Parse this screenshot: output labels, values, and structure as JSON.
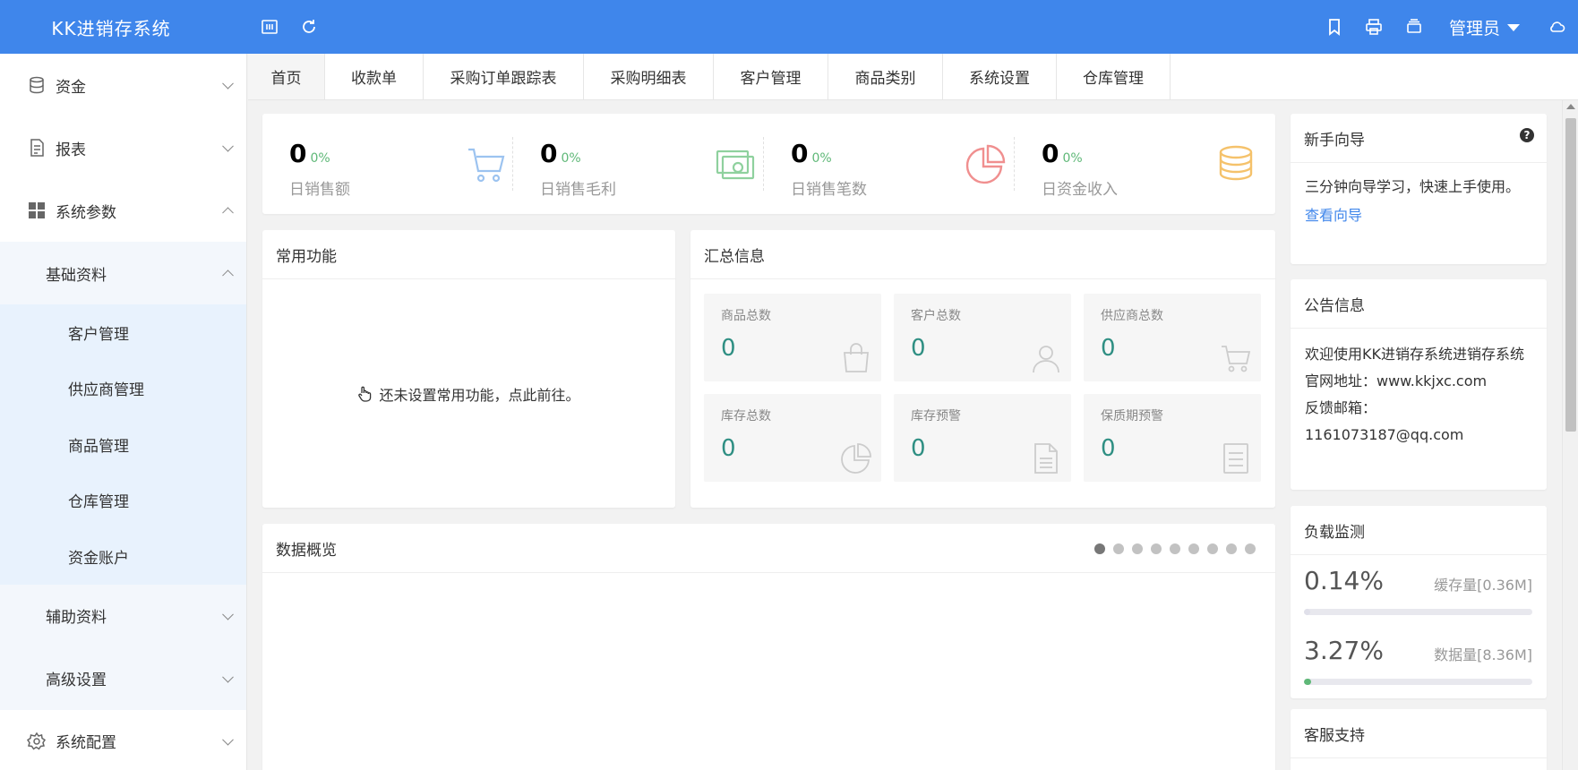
{
  "header": {
    "title": "KK进销存系统",
    "user": "管理员",
    "bg_color": "#3f86eb",
    "icons": [
      "collapse-menu-icon",
      "refresh-icon",
      "bookmark-icon",
      "print-icon",
      "layers-icon",
      "cloud-icon"
    ]
  },
  "sidebar": {
    "items": [
      {
        "label": "资金",
        "icon": "database-icon",
        "expanded": false
      },
      {
        "label": "报表",
        "icon": "report-icon",
        "expanded": false
      },
      {
        "label": "系统参数",
        "icon": "grid-icon",
        "expanded": true
      },
      {
        "label": "基础资料",
        "expanded": true
      },
      {
        "label": "客户管理"
      },
      {
        "label": "供应商管理"
      },
      {
        "label": "商品管理"
      },
      {
        "label": "仓库管理"
      },
      {
        "label": "资金账户"
      },
      {
        "label": "辅助资料",
        "expanded": false
      },
      {
        "label": "高级设置",
        "expanded": false
      },
      {
        "label": "系统配置",
        "icon": "gear-icon",
        "expanded": false
      }
    ]
  },
  "tabs": [
    "首页",
    "收款单",
    "采购订单跟踪表",
    "采购明细表",
    "客户管理",
    "商品类别",
    "系统设置",
    "仓库管理"
  ],
  "stats": [
    {
      "value": "0",
      "pct": "0%",
      "label": "日销售额",
      "icon": "cart-icon",
      "color": "#9cc3f0"
    },
    {
      "value": "0",
      "pct": "0%",
      "label": "日销售毛利",
      "icon": "money-icon",
      "color": "#8fd19e"
    },
    {
      "value": "0",
      "pct": "0%",
      "label": "日销售笔数",
      "icon": "pie-icon",
      "color": "#f08f8f"
    },
    {
      "value": "0",
      "pct": "0%",
      "label": "日资金收入",
      "icon": "coins-icon",
      "color": "#f5c26b"
    }
  ],
  "common": {
    "title": "常用功能",
    "empty_text": "还未设置常用功能，点此前往。"
  },
  "summary": {
    "title": "汇总信息",
    "cards": [
      {
        "label": "商品总数",
        "value": "0",
        "icon": "bag-icon"
      },
      {
        "label": "客户总数",
        "value": "0",
        "icon": "user-icon"
      },
      {
        "label": "供应商总数",
        "value": "0",
        "icon": "cart-icon"
      },
      {
        "label": "库存总数",
        "value": "0",
        "icon": "pie-icon"
      },
      {
        "label": "库存预警",
        "value": "0",
        "icon": "document-icon"
      },
      {
        "label": "保质期预警",
        "value": "0",
        "icon": "list-icon"
      }
    ]
  },
  "overview": {
    "title": "数据概览",
    "dot_count": 9,
    "active_dot": 0
  },
  "guide": {
    "title": "新手向导",
    "text": "三分钟向导学习，快速上手使用。",
    "link": "查看向导"
  },
  "notice": {
    "title": "公告信息",
    "line1": "欢迎使用KK进销存系统进销存系统",
    "line2": "官网地址：www.kkjxc.com",
    "line3": "反馈邮箱：",
    "line4": "1161073187@qq.com"
  },
  "load": {
    "title": "负载监测",
    "cache_pct": "0.14%",
    "cache_label": "缓存量[0.36M]",
    "cache_fraction": 0.0014,
    "data_pct": "3.27%",
    "data_label": "数据量[8.36M]",
    "data_fraction": 0.0327
  },
  "support": {
    "title": "客服支持"
  }
}
